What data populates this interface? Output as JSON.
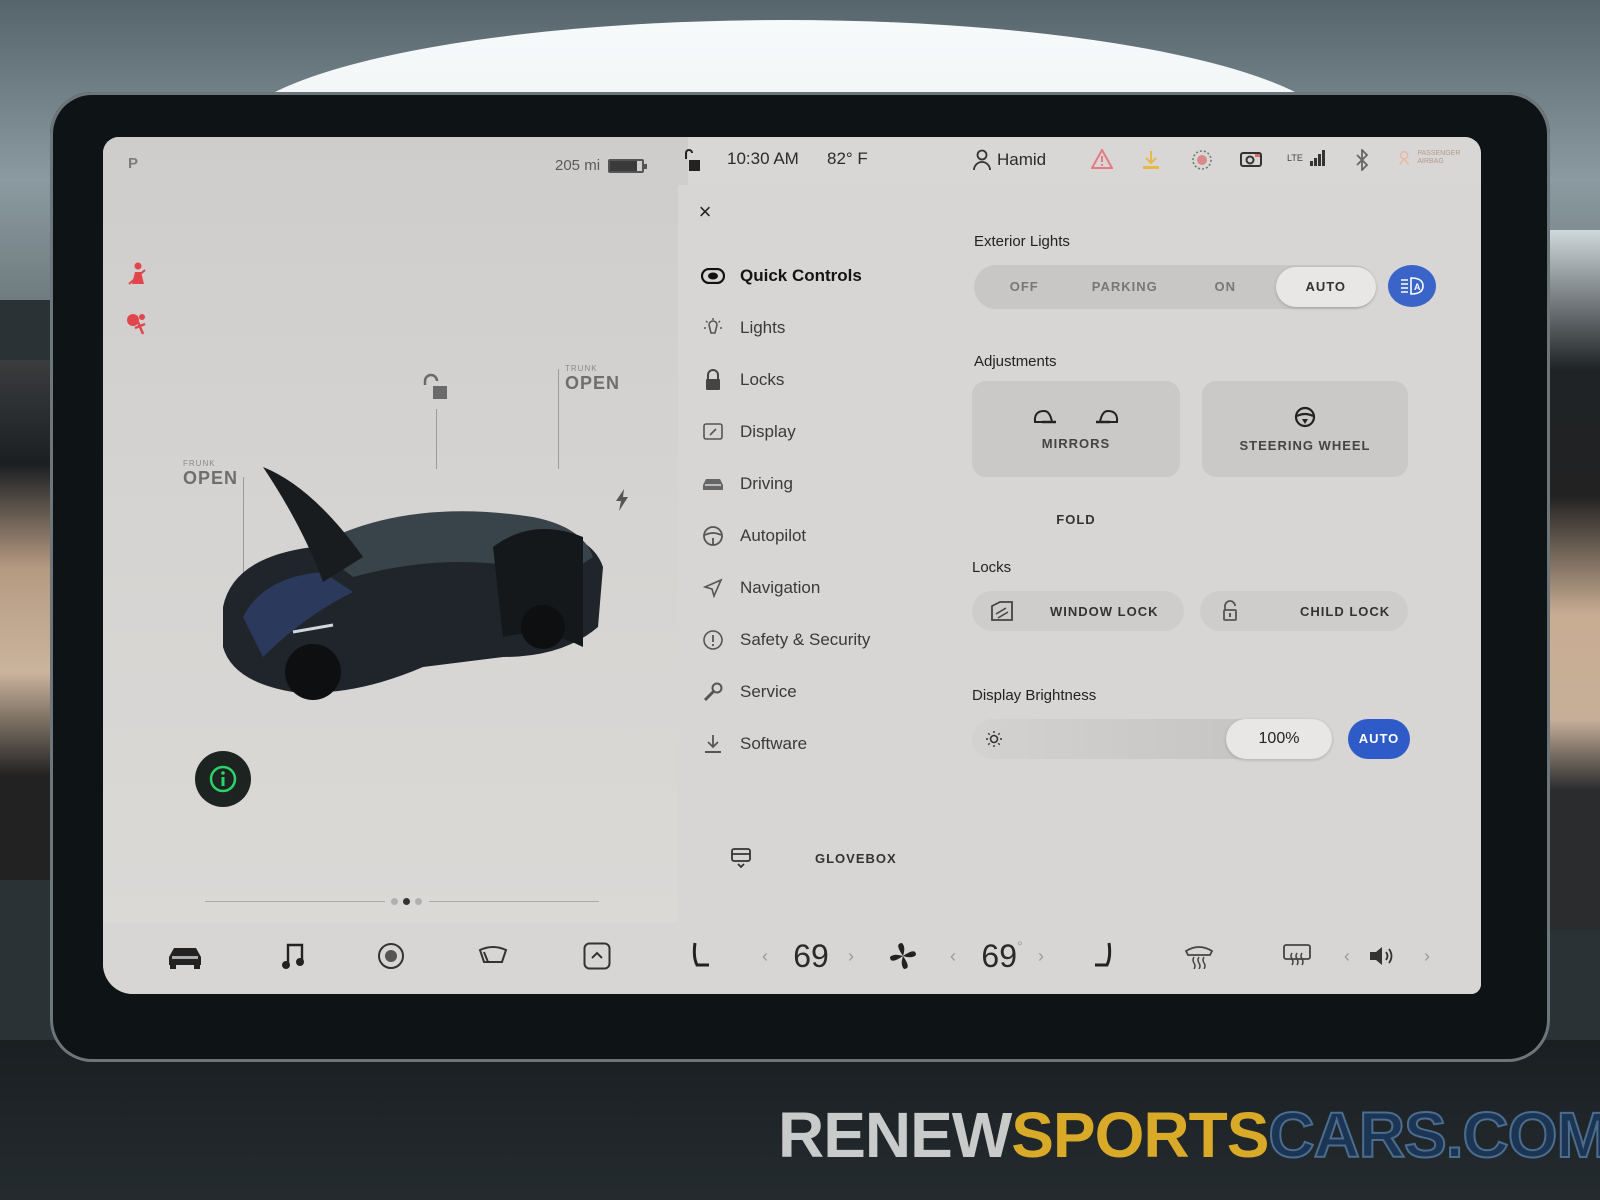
{
  "status_bar": {
    "range": "205 mi",
    "battery_level": 0.85,
    "time": "10:30 AM",
    "temperature": "82° F",
    "user": "Hamid",
    "icons": [
      "lock-icon",
      "user-icon",
      "warning-icon",
      "download-icon",
      "sentry-icon",
      "dashcam-icon",
      "lte-signal-icon",
      "bluetooth-icon",
      "passenger-airbag-icon"
    ],
    "lte_label": "LTE",
    "passenger_airbag_label": "PASSENGER AIRBAG"
  },
  "car_pane": {
    "gear": "P",
    "frunk": {
      "small_label": "FRUNK",
      "state": "OPEN"
    },
    "trunk": {
      "small_label": "TRUNK",
      "state": "OPEN"
    },
    "lock_state": "unlocked",
    "charge_port_icon": "bolt-icon",
    "telltales": [
      "seatbelt-warning-icon",
      "airbag-warning-icon"
    ],
    "pager": {
      "pages": 3,
      "active": 1
    }
  },
  "panel": {
    "close_label": "×",
    "nav": [
      {
        "label": "Quick Controls",
        "icon": "eye-icon",
        "active": true
      },
      {
        "label": "Lights",
        "icon": "bulb-icon",
        "active": false
      },
      {
        "label": "Locks",
        "icon": "lock-icon",
        "active": false
      },
      {
        "label": "Display",
        "icon": "display-icon",
        "active": false
      },
      {
        "label": "Driving",
        "icon": "car-icon",
        "active": false
      },
      {
        "label": "Autopilot",
        "icon": "steering-wheel-icon",
        "active": false
      },
      {
        "label": "Navigation",
        "icon": "navigation-arrow-icon",
        "active": false
      },
      {
        "label": "Safety & Security",
        "icon": "info-circle-icon",
        "active": false
      },
      {
        "label": "Service",
        "icon": "wrench-icon",
        "active": false
      },
      {
        "label": "Software",
        "icon": "download-icon",
        "active": false
      }
    ],
    "glovebox_label": "GLOVEBOX",
    "exterior_lights": {
      "title": "Exterior Lights",
      "options": [
        "OFF",
        "PARKING",
        "ON",
        "AUTO"
      ],
      "selected": "AUTO",
      "auto_high_beam_active": true
    },
    "adjustments": {
      "title": "Adjustments",
      "mirrors_label": "MIRRORS",
      "steering_label": "STEERING WHEEL",
      "fold_label": "FOLD"
    },
    "locks": {
      "title": "Locks",
      "window_lock_label": "WINDOW LOCK",
      "child_lock_label": "CHILD LOCK"
    },
    "display_brightness": {
      "title": "Display Brightness",
      "value_label": "100%",
      "value": 100,
      "auto_label": "AUTO"
    }
  },
  "bottom_bar": {
    "driver_temp": "69",
    "passenger_temp": "69",
    "degree": "°",
    "items": [
      "car-icon",
      "music-icon",
      "camera-icon",
      "wiper-icon",
      "app-launcher-icon",
      "driver-seat-heater-icon",
      "fan-icon",
      "passenger-seat-heater-icon",
      "front-defrost-icon",
      "rear-defrost-icon",
      "volume-icon"
    ]
  },
  "colors": {
    "accent_blue": "#2f5bc9",
    "warning_red": "#e0464b",
    "info_green": "#2bd46b"
  },
  "watermark": {
    "part1": "RENEW",
    "part2": "SPORTS",
    "part3": "CARS.COM"
  }
}
